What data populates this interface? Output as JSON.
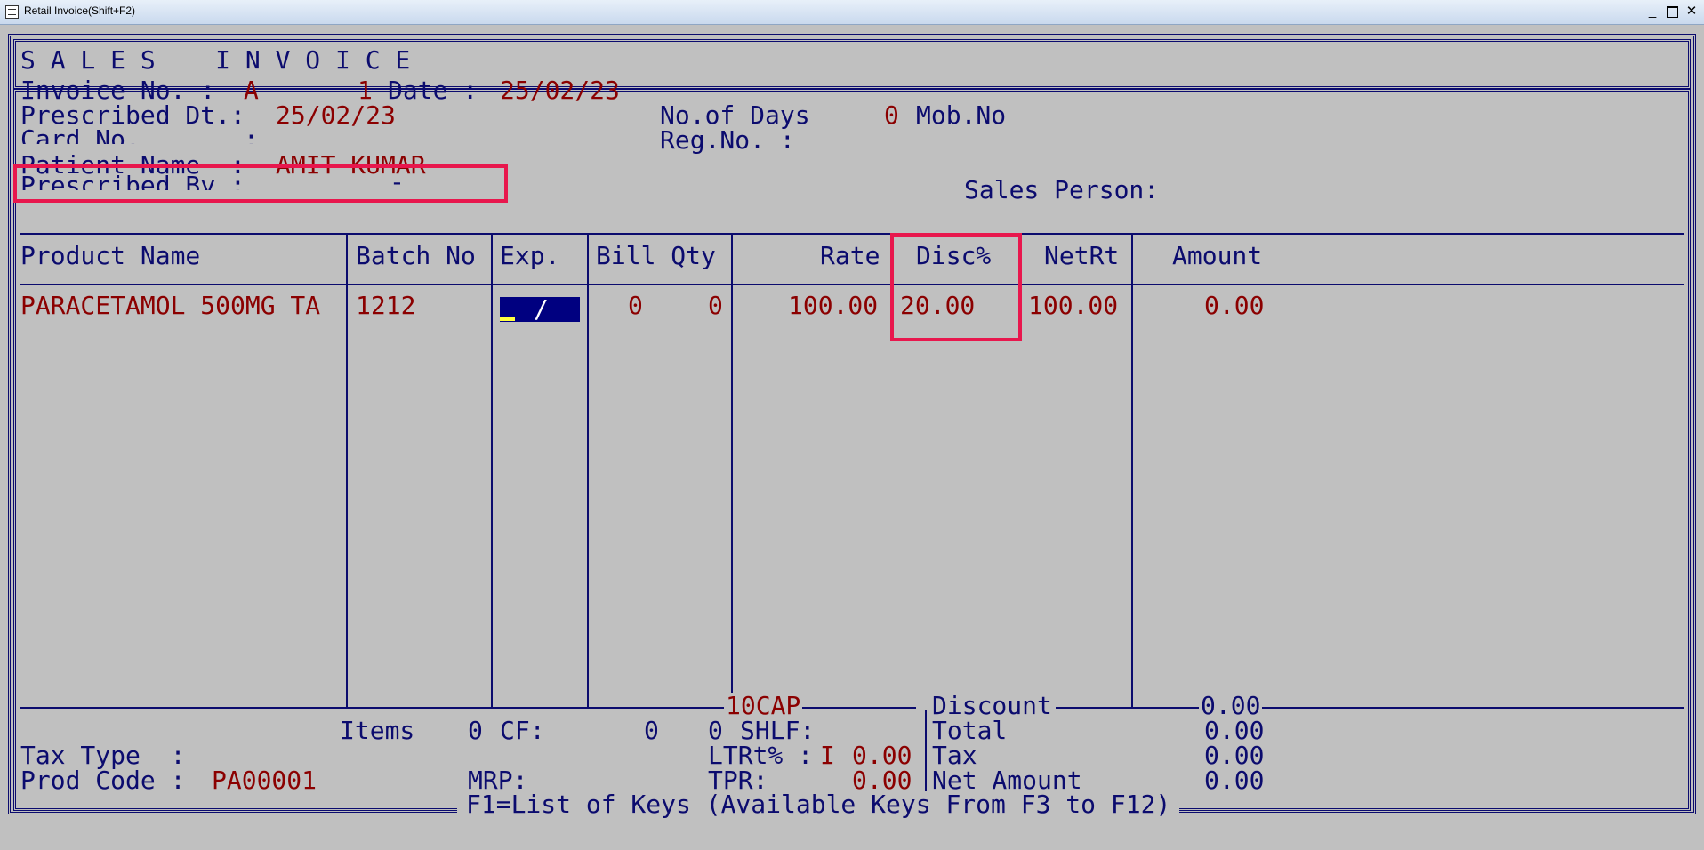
{
  "window": {
    "title": "Retail Invoice(Shift+F2)",
    "min_label": "_",
    "close_label": "✕"
  },
  "header": {
    "title": "S A L E S    I N V O I C E"
  },
  "invoice": {
    "invoice_no_label": "Invoice No. :",
    "invoice_series": "A",
    "invoice_number": "1",
    "date_label": "Date :",
    "date_value": "25/02/23",
    "prescribed_dt_label": "Prescribed Dt.:",
    "prescribed_dt_value": "25/02/23",
    "no_of_days_label": "No.of Days",
    "no_of_days_value": "0",
    "mob_no_label": "Mob.No",
    "card_no_label": "Card No.",
    "card_no_colon": ":",
    "reg_no_label": "Reg.No. :",
    "patient_name_label": "Patient Name  :",
    "patient_name_value": "AMIT KUMAR",
    "prescribed_by_label": "Prescribed By :",
    "prescribed_by_value": "-",
    "sales_person_label": "Sales Person:"
  },
  "table": {
    "headers": {
      "product_name": "Product Name",
      "batch_no": "Batch No",
      "exp": "Exp.",
      "bill_qty": "Bill Qty",
      "rate": "Rate",
      "disc": "Disc%",
      "netrt": "NetRt",
      "amount": "Amount"
    },
    "rows": [
      {
        "product_name": "PARACETAMOL 500MG TA",
        "batch_no": "1212",
        "exp": "/",
        "bill": "0",
        "qty": "0",
        "rate": "100.00",
        "disc": "20.00",
        "netrt": "100.00",
        "amount": "0.00"
      }
    ]
  },
  "footer": {
    "pack": "10CAP",
    "discount_label": "Discount",
    "discount_value": "0.00",
    "items_label": "Items",
    "items_value": "0",
    "cf_label": "CF:",
    "cf_value": "0",
    "shlf_value": "0",
    "shlf_label": "SHLF:",
    "total_label": "Total",
    "total_value": "0.00",
    "tax_type_label": "Tax Type  :",
    "ltrt_label": "LTRt% :",
    "ltrt_flag": "I",
    "ltrt_value": "0.00",
    "tax_label": "Tax",
    "tax_value": "0.00",
    "prod_code_label": "Prod Code :",
    "prod_code_value": "PA00001",
    "mrp_label": "MRP:",
    "tpr_label": "TPR:",
    "tpr_value": "0.00",
    "net_amount_label": "Net Amount",
    "net_amount_value": "0.00",
    "keys_hint": "F1=List of Keys (Available Keys From F3 to F12)"
  },
  "colors": {
    "frame": "#0b0b6e",
    "value": "#8b0000",
    "background": "#c0c0c0",
    "highlight": "#e8174d",
    "exp_cell": "#000080",
    "cursor": "#ffff40"
  }
}
